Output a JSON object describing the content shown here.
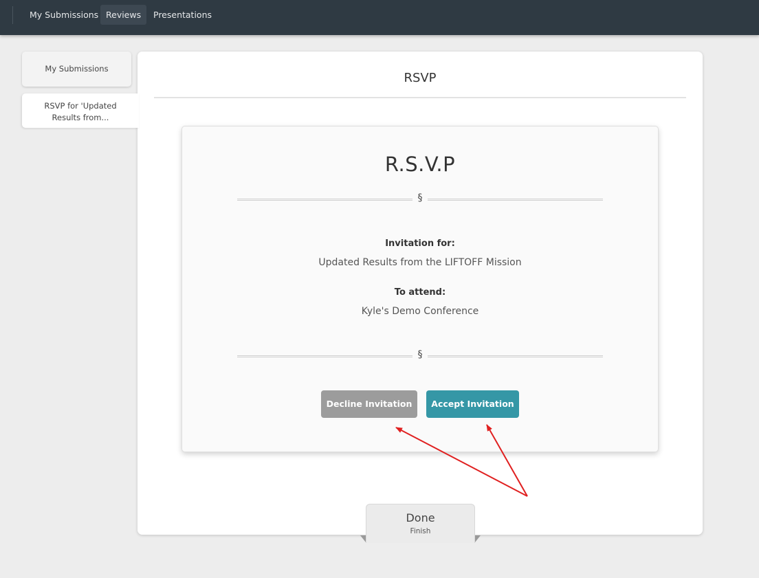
{
  "topbar": {
    "nav": [
      {
        "label": "My Submissions",
        "active": false
      },
      {
        "label": "Reviews",
        "active": true
      },
      {
        "label": "Presentations",
        "active": false
      }
    ]
  },
  "sidebar": {
    "tabs": [
      {
        "label": "My Submissions"
      },
      {
        "label": "RSVP for 'Updated Results from..."
      }
    ]
  },
  "panel": {
    "title": "RSVP"
  },
  "card": {
    "title": "R.S.V.P",
    "divider_glyph": "§",
    "invitation_label": "Invitation for:",
    "invitation_value": "Updated Results from the LIFTOFF Mission",
    "attend_label": "To attend:",
    "attend_value": "Kyle's Demo Conference",
    "decline_label": "Decline Invitation",
    "accept_label": "Accept Invitation"
  },
  "done_tab": {
    "title": "Done",
    "subtitle": "Finish"
  },
  "colors": {
    "topbar": "#2f3a43",
    "accept": "#3597a6",
    "decline": "#9c9c9c",
    "annotation_arrow": "#e02020"
  }
}
